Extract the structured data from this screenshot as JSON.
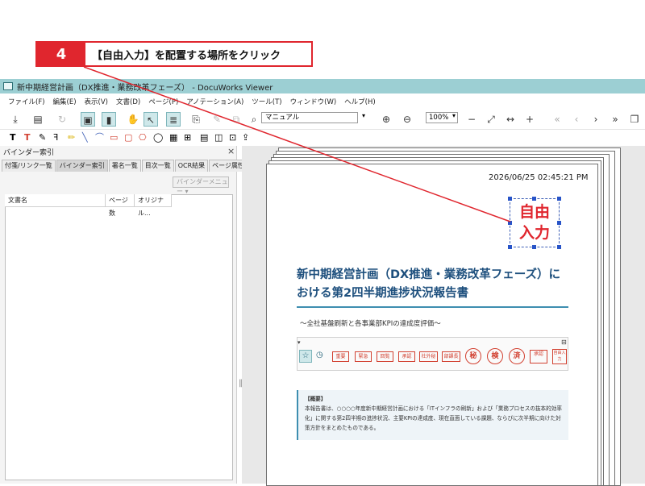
{
  "callout": {
    "step": "4",
    "text": "【自由入力】を配置する場所をクリック"
  },
  "window": {
    "title": "新中期経営計画（DX推進・業務改革フェーズ） - DocuWorks Viewer"
  },
  "menu": [
    "ファイル(F)",
    "編集(E)",
    "表示(V)",
    "文書(D)",
    "ページ(P)",
    "アノテーション(A)",
    "ツール(T)",
    "ウィンドウ(W)",
    "ヘルプ(H)"
  ],
  "toolbar": {
    "search_value": "マニュアル",
    "zoom_value": "100%"
  },
  "panel": {
    "title": "バインダー索引",
    "close": "×",
    "tabs": [
      "付箋/リンク一覧",
      "バインダー索引",
      "署名一覧",
      "目次一覧",
      "OCR結果",
      "ページ属性"
    ],
    "binder_menu": "バインダーメニュー",
    "columns": [
      "文書名",
      "ページ数",
      "オリジナル..."
    ]
  },
  "document": {
    "timestamp": "2026/06/25 02:45:21 PM",
    "free_input": [
      "自由",
      "入力"
    ],
    "title_lines": [
      "新中期経営計画（DX推進・業務改革フェーズ）に",
      "おける第2四半期進捗状況報告書"
    ],
    "subtitle": "〜全社基盤刷新と各事業部KPIの達成度評価〜",
    "stamps": {
      "boxes": [
        "重要",
        "緊急",
        "回覧",
        "承認",
        "社外秘",
        "部課長"
      ],
      "circles": [
        "秘",
        "検",
        "済"
      ],
      "approve": "承認",
      "free": "自由入力"
    },
    "summary_heading": "【概要】",
    "summary_lines": [
      "本報告書は、○○○○年度新中期経営計画における「ITインフラの刷新」および「業務プロセスの抜本的効率",
      "化」に関する第2四半期の進捗状況、主要KPIの達成度、現在直面している課題、ならびに次半期に向けた対",
      "策方針をまとめたものである。"
    ]
  },
  "colors": {
    "accent_red": "#e0262e",
    "title_bar": "#9ccfd3",
    "doc_title": "#1d4f7d"
  }
}
